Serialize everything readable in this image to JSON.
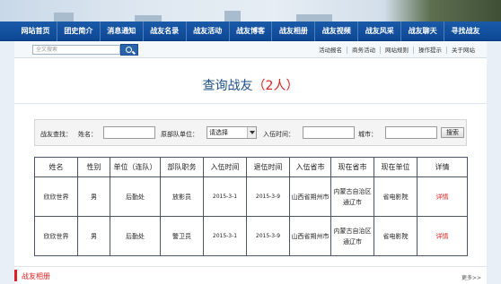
{
  "nav": {
    "items": [
      "网站首页",
      "团史简介",
      "消息通知",
      "战友名录",
      "战友活动",
      "战友博客",
      "战友相册",
      "战友视频",
      "战友风采",
      "战友聊天",
      "寻找战友"
    ]
  },
  "subbar": {
    "search_placeholder": "全文搜索",
    "links": [
      "活动报名",
      "商务活动",
      "网站规则",
      "操作提示",
      "关于网站"
    ]
  },
  "page": {
    "title": "查询战友",
    "count": "（2人）"
  },
  "filter": {
    "label_query": "战友查找：",
    "label_name": "姓名：",
    "label_unit": "原部队单位：",
    "unit_selected": "请选择",
    "label_enlist": "入伍时间：",
    "label_city": "城市：",
    "search_button": "搜索"
  },
  "table": {
    "headers": [
      "姓名",
      "性别",
      "单位（连队）",
      "部队职务",
      "入伍时间",
      "退伍时间",
      "入伍省市",
      "现在省市",
      "现在单位",
      "详情"
    ],
    "rows": [
      [
        "欣欣世界",
        "男",
        "后勤处",
        "放影员",
        "2015-3-1",
        "2015-3-9",
        "山西省朔州市",
        "内蒙古自治区通辽市",
        "省电影院",
        "详情"
      ],
      [
        "欣欣世界",
        "男",
        "后勤处",
        "警卫员",
        "2015-3-1",
        "2015-3-9",
        "山西省朔州市",
        "内蒙古自治区通辽市",
        "省电影院",
        "详情"
      ]
    ]
  },
  "album": {
    "title": "战友相册",
    "more": "更多>>"
  },
  "colors": {
    "nav_blue": "#0d4794",
    "accent_red": "#e02020",
    "title_blue": "#1b4f8a"
  }
}
